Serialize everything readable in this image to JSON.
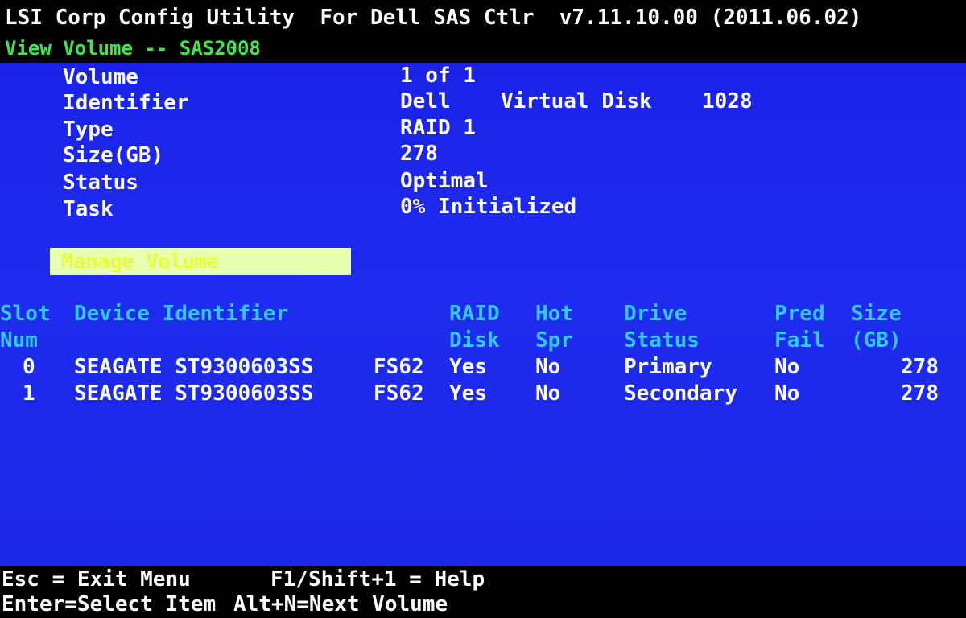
{
  "header": {
    "title": "LSI Corp Config Utility  For Dell SAS Ctlr  v7.11.10.00 (2011.06.02)",
    "subtitle": "View Volume -- SAS2008"
  },
  "volume_info": {
    "volume_label": "Volume",
    "volume_value": "1 of 1",
    "identifier_label": "Identifier",
    "identifier_vendor": "Dell",
    "identifier_product": "Virtual Disk",
    "identifier_rev": "1028",
    "type_label": "Type",
    "type_value": "RAID 1",
    "size_label": "Size(GB)",
    "size_value": "278",
    "status_label": "Status",
    "status_value": "Optimal",
    "task_label": "Task",
    "task_value": "0% Initialized"
  },
  "manage_volume": {
    "label": "Manage Volume"
  },
  "table": {
    "headers": {
      "slot_1": "Slot",
      "slot_2": "Num",
      "device": "Device Identifier",
      "raid_1": "RAID",
      "raid_2": "Disk",
      "hot_1": "Hot",
      "hot_2": "Spr",
      "drive_1": "Drive",
      "drive_2": "Status",
      "pred_1": "Pred",
      "pred_2": "Fail",
      "size_1": "Size",
      "size_2": "(GB)"
    },
    "rows": [
      {
        "slot": "0",
        "device": "SEAGATE ST9300603SS",
        "firmware": "FS62",
        "raid_disk": "Yes",
        "hot_spare": "No",
        "drive_status": "Primary",
        "pred_fail": "No",
        "size": "278"
      },
      {
        "slot": "1",
        "device": "SEAGATE ST9300603SS",
        "firmware": "FS62",
        "raid_disk": "Yes",
        "hot_spare": "No",
        "drive_status": "Secondary",
        "pred_fail": "No",
        "size": "278"
      }
    ]
  },
  "footer": {
    "esc_hint": "Esc = Exit Menu",
    "f1_hint": "F1/Shift+1 = Help",
    "enter_hint": "Enter=Select Item",
    "alt_hint": "Alt+N=Next Volume"
  },
  "colors": {
    "panel_background": "#1f2cf0",
    "header_background": "#000000",
    "title_text": "#ffffff",
    "subtitle_text": "#3fe64d",
    "column_header_text": "#33c8ff",
    "body_text": "#ffffff",
    "highlight_background": "#e6ffb0",
    "highlight_text": "#e8ff34"
  }
}
